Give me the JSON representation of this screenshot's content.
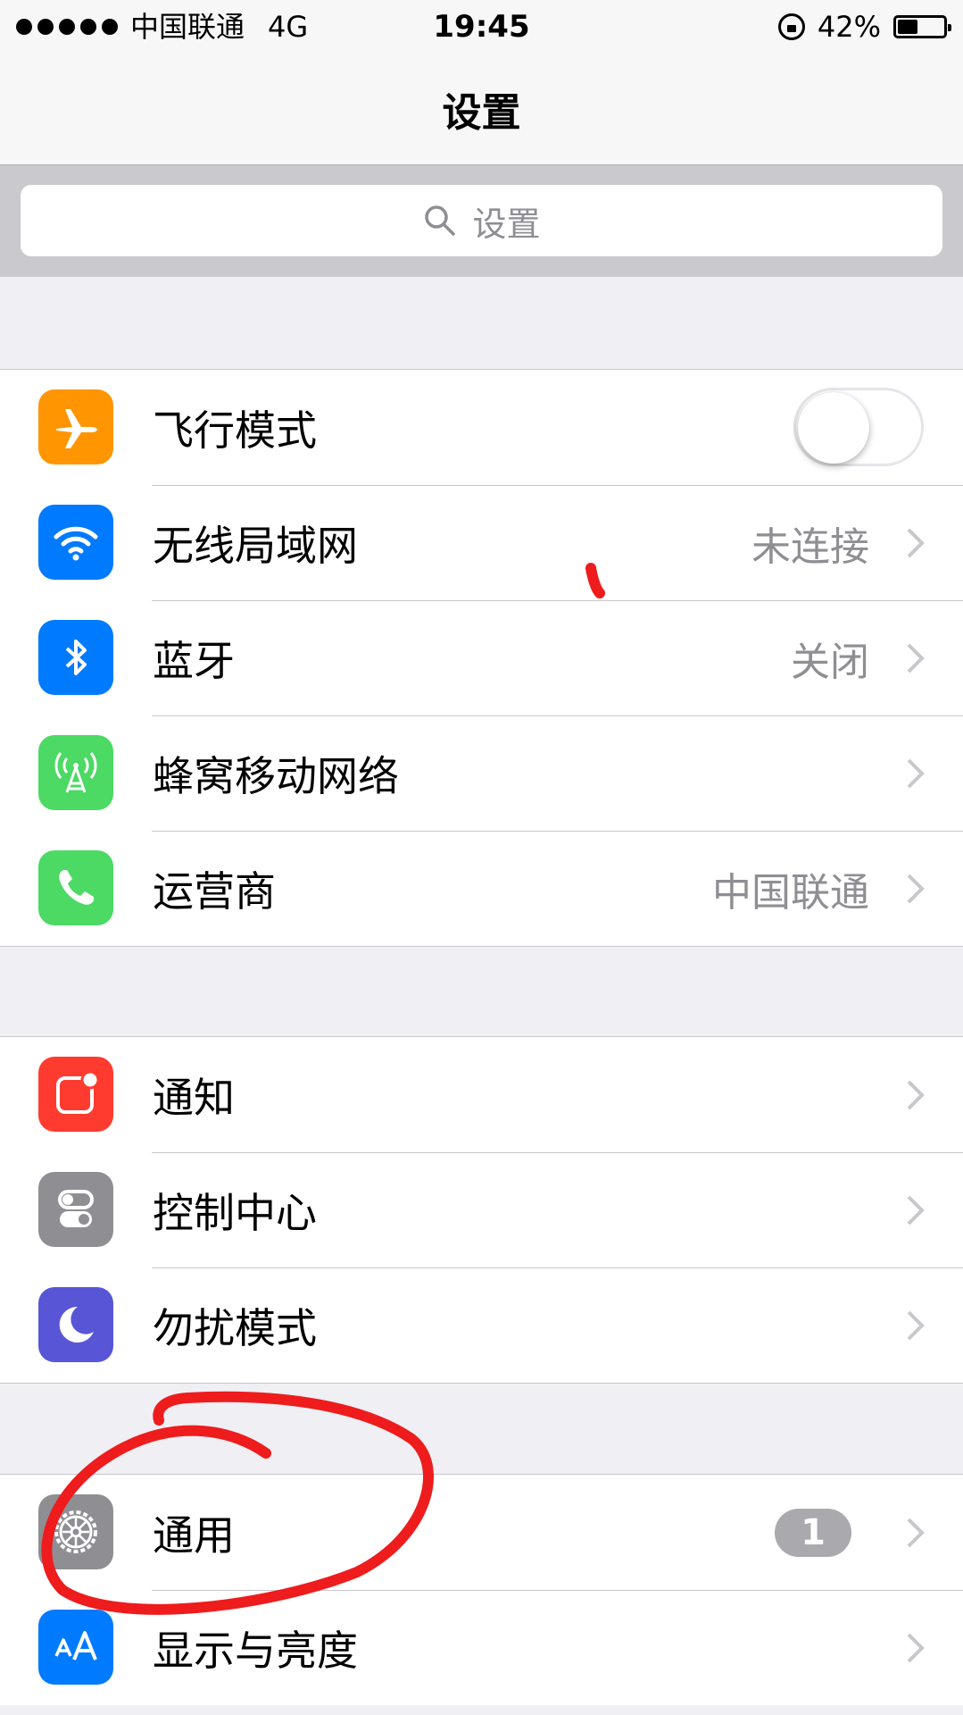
{
  "status_bar": {
    "carrier": "中国联通",
    "network": "4G",
    "time": "19:45",
    "battery_percent": "42%",
    "battery_level": 0.42
  },
  "nav": {
    "title": "设置"
  },
  "search": {
    "placeholder": "设置"
  },
  "groups": [
    {
      "rows": [
        {
          "label": "飞行模式",
          "icon": "airplane-icon",
          "icon_color": "#ff9500",
          "control": "toggle",
          "toggle_on": false
        },
        {
          "label": "无线局域网",
          "icon": "wifi-icon",
          "icon_color": "#007aff",
          "detail": "未连接"
        },
        {
          "label": "蓝牙",
          "icon": "bluetooth-icon",
          "icon_color": "#007aff",
          "detail": "关闭"
        },
        {
          "label": "蜂窝移动网络",
          "icon": "cellular-icon",
          "icon_color": "#4cd964"
        },
        {
          "label": "运营商",
          "icon": "phone-icon",
          "icon_color": "#4cd964",
          "detail": "中国联通"
        }
      ]
    },
    {
      "rows": [
        {
          "label": "通知",
          "icon": "notifications-icon",
          "icon_color": "#ff3b30"
        },
        {
          "label": "控制中心",
          "icon": "control-center-icon",
          "icon_color": "#8e8e93"
        },
        {
          "label": "勿扰模式",
          "icon": "moon-icon",
          "icon_color": "#5856d6"
        }
      ]
    },
    {
      "rows": [
        {
          "label": "通用",
          "icon": "gear-icon",
          "icon_color": "#8e8e93",
          "badge": "1"
        },
        {
          "label": "显示与亮度",
          "icon": "text-size-icon",
          "icon_color": "#007aff"
        }
      ]
    }
  ]
}
